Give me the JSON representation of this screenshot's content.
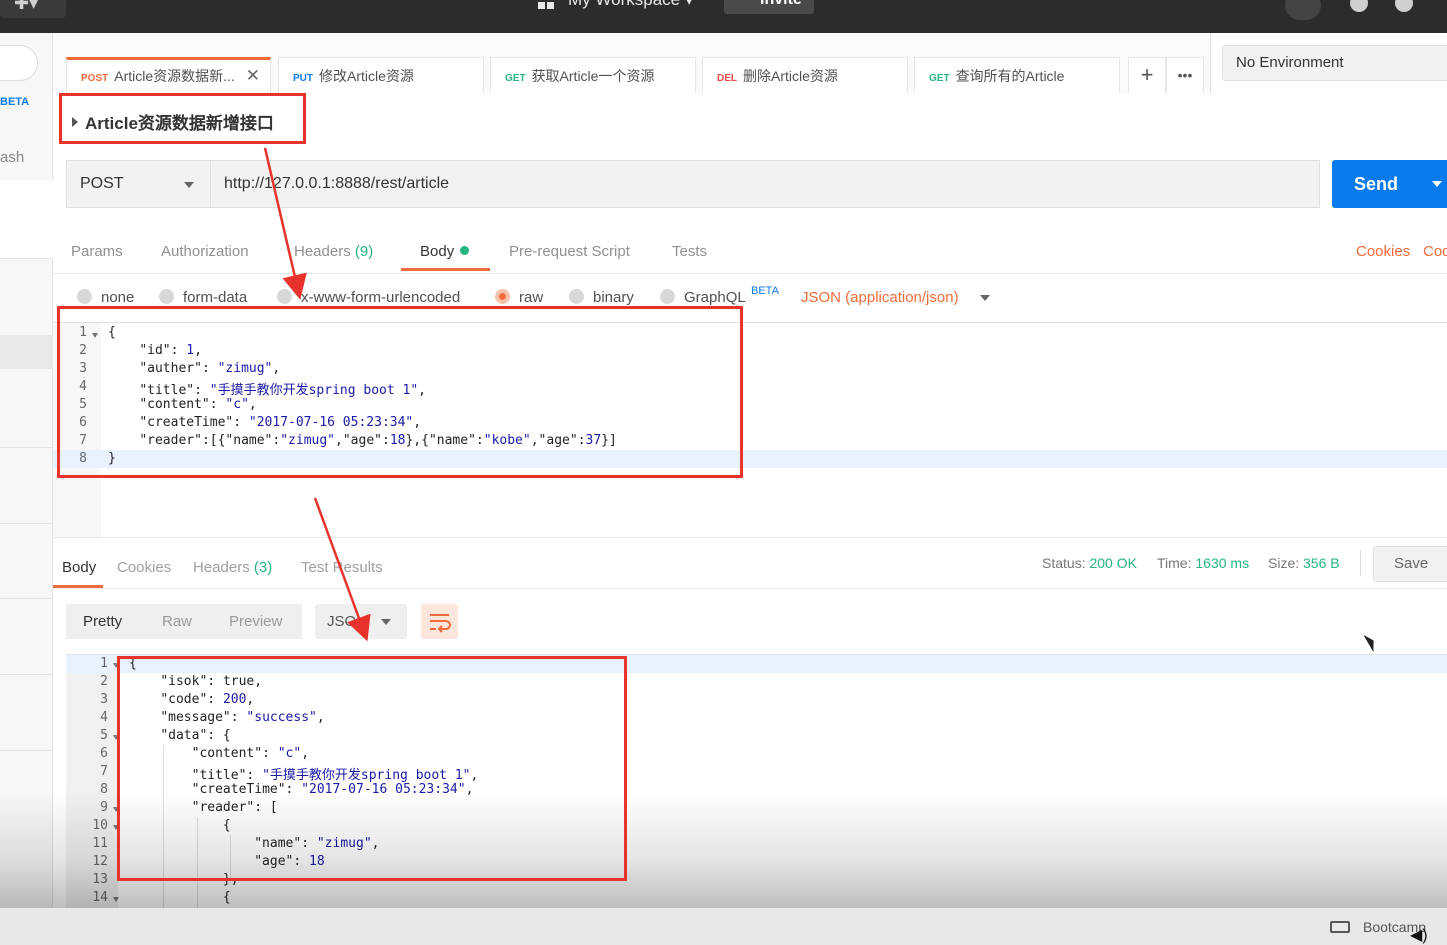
{
  "topbar": {
    "workspace": "My Workspace",
    "invite": "Invite"
  },
  "sidebar": {
    "beta": "BETA",
    "history_fragment": "ash"
  },
  "tabs": [
    {
      "method": "POST",
      "method_color": "#f26b3a",
      "label": "Article资源数据新...",
      "active": true
    },
    {
      "method": "PUT",
      "method_color": "#097bed",
      "label": "修改Article资源"
    },
    {
      "method": "GET",
      "method_color": "#26b47f",
      "label": "获取Article一个资源"
    },
    {
      "method": "DEL",
      "method_color": "#ed4b48",
      "label": "删除Article资源"
    },
    {
      "method": "GET",
      "method_color": "#26b47f",
      "label": "查询所有的Article"
    }
  ],
  "tab_actions": {
    "add": "+",
    "more": "•••"
  },
  "environment": "No Environment",
  "request": {
    "name": "Article资源数据新增接口",
    "method": "POST",
    "url": "http://127.0.0.1:8888/rest/article",
    "send": "Send"
  },
  "request_tabs": {
    "params": "Params",
    "authorization": "Authorization",
    "headers": "Headers",
    "headers_count": "(9)",
    "body": "Body",
    "prerequest": "Pre-request Script",
    "tests": "Tests",
    "cookies": "Cookies",
    "code": "Code"
  },
  "body_modes": {
    "none": "none",
    "form_data": "form-data",
    "urlencoded": "x-www-form-urlencoded",
    "raw": "raw",
    "binary": "binary",
    "graphql": "GraphQL",
    "graphql_badge": "BETA",
    "content_type": "JSON (application/json)"
  },
  "request_body": {
    "line_numbers": [
      "1",
      "2",
      "3",
      "4",
      "5",
      "6",
      "7",
      "8"
    ],
    "lines": [
      "{",
      "    \"id\": 1,",
      "    \"auther\": \"zimug\",",
      "    \"title\": \"手摸手教你开发spring boot 1\",",
      "    \"content\": \"c\",",
      "    \"createTime\": \"2017-07-16 05:23:34\",",
      "    \"reader\":[{\"name\":\"zimug\",\"age\":18},{\"name\":\"kobe\",\"age\":37}]",
      "}"
    ]
  },
  "response_tabs": {
    "body": "Body",
    "cookies": "Cookies",
    "headers": "Headers",
    "headers_count": "(3)",
    "test_results": "Test Results"
  },
  "response_meta": {
    "status_label": "Status:",
    "status": "200 OK",
    "time_label": "Time:",
    "time": "1630 ms",
    "size_label": "Size:",
    "size": "356 B",
    "save": "Save"
  },
  "view_modes": {
    "pretty": "Pretty",
    "raw": "Raw",
    "preview": "Preview",
    "format": "JSON"
  },
  "response_body": {
    "line_numbers": [
      "1",
      "2",
      "3",
      "4",
      "5",
      "6",
      "7",
      "8",
      "9",
      "10",
      "11",
      "12",
      "13",
      "14"
    ],
    "lines": [
      "{",
      "    \"isok\": true,",
      "    \"code\": 200,",
      "    \"message\": \"success\",",
      "    \"data\": {",
      "        \"content\": \"c\",",
      "        \"title\": \"手摸手教你开发spring boot 1\",",
      "        \"createTime\": \"2017-07-16 05:23:34\",",
      "        \"reader\": [",
      "            {",
      "                \"name\": \"zimug\",",
      "                \"age\": 18",
      "            },",
      "            {"
    ]
  },
  "footer": {
    "bootcamp": "Bootcamp"
  }
}
